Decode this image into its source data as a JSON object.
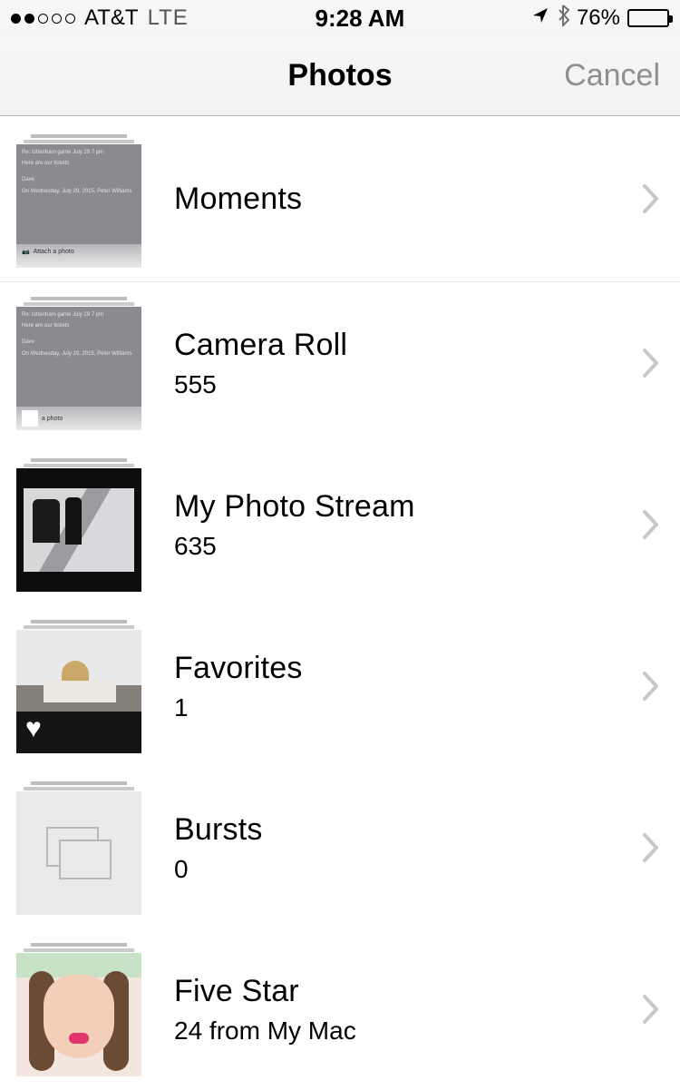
{
  "status_bar": {
    "carrier": "AT&T",
    "network": "LTE",
    "time": "9:28 AM",
    "battery_percent": "76%",
    "battery_fill_width": "76%",
    "signal_filled": 2,
    "signal_total": 5
  },
  "nav": {
    "title": "Photos",
    "cancel": "Cancel"
  },
  "albums": [
    {
      "title": "Moments",
      "count": ""
    },
    {
      "title": "Camera Roll",
      "count": "555"
    },
    {
      "title": "My Photo Stream",
      "count": "635"
    },
    {
      "title": "Favorites",
      "count": "1"
    },
    {
      "title": "Bursts",
      "count": "0"
    },
    {
      "title": "Five Star",
      "count": "24 from My Mac"
    }
  ]
}
